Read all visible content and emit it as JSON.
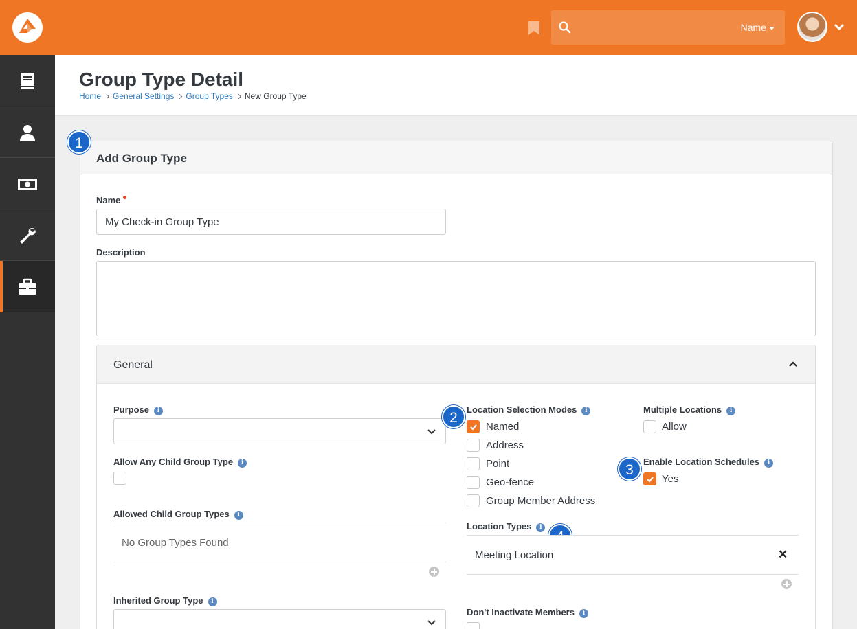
{
  "header": {
    "search": {
      "placeholder": "",
      "filter_label": "Name"
    }
  },
  "page": {
    "title": "Group Type Detail",
    "breadcrumb": [
      "Home",
      "General Settings",
      "Group Types",
      "New Group Type"
    ]
  },
  "panel": {
    "badge": "1",
    "title": "Add Group Type",
    "name_label": "Name",
    "name_value": "My Check-in Group Type",
    "description_label": "Description",
    "description_value": ""
  },
  "general": {
    "title": "General",
    "purpose_label": "Purpose",
    "purpose_value": "",
    "allow_any_child_label": "Allow Any Child Group Type",
    "allow_any_child_checked": false,
    "allowed_child_label": "Allowed Child Group Types",
    "allowed_child_empty": "No Group Types Found",
    "inherited_label": "Inherited Group Type",
    "inherited_value": "",
    "location_modes": {
      "badge": "2",
      "label": "Location Selection Modes",
      "options": [
        {
          "label": "Named",
          "checked": true
        },
        {
          "label": "Address",
          "checked": false
        },
        {
          "label": "Point",
          "checked": false
        },
        {
          "label": "Geo-fence",
          "checked": false
        },
        {
          "label": "Group Member Address",
          "checked": false
        }
      ]
    },
    "multiple_locations": {
      "label": "Multiple Locations",
      "option": "Allow",
      "checked": false
    },
    "location_schedules": {
      "badge": "3",
      "label": "Enable Location Schedules",
      "option": "Yes",
      "checked": true
    },
    "location_types": {
      "badge": "4",
      "label": "Location Types",
      "items": [
        "Meeting Location"
      ]
    },
    "dont_inactivate": {
      "label": "Don't Inactivate Members"
    }
  },
  "colors": {
    "brand": "#ee7625",
    "sidebar": "#323232",
    "badge": "#1b66c9",
    "link": "#2e7bbf"
  }
}
